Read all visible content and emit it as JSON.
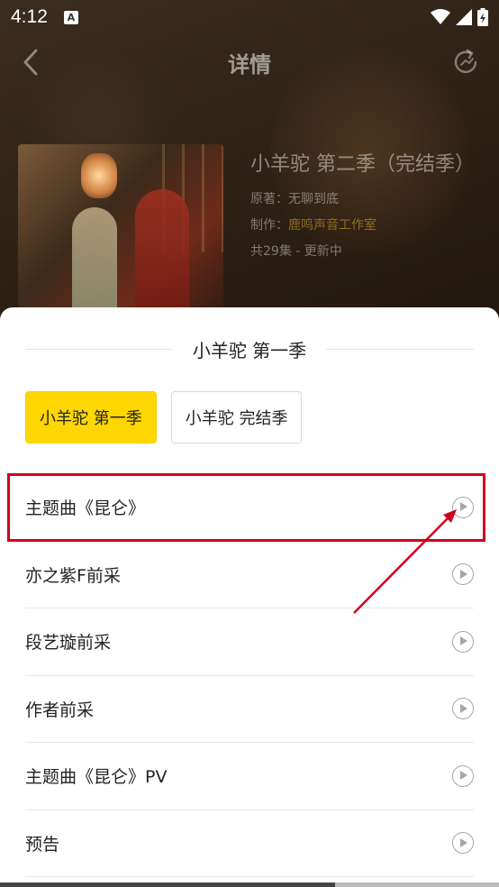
{
  "status_bar": {
    "time": "4:12",
    "notification_badge": "A"
  },
  "nav": {
    "title": "详情",
    "back_icon": "chevron-left-icon",
    "refresh_icon": "refresh-icon"
  },
  "album": {
    "title": "小羊驼 第二季（完结季）",
    "author": "原著：无聊到底",
    "producer_label": "制作：",
    "producer": "鹿鸣声音工作室",
    "episodes": "共29集 - 更新中"
  },
  "sheet": {
    "title": "小羊驼 第一季",
    "seasons": [
      {
        "label": "小羊驼  第一季",
        "active": true
      },
      {
        "label": "小羊驼  完结季",
        "active": false
      }
    ],
    "tracks": [
      {
        "name": "主题曲《昆仑》",
        "icon": "play-circle-icon"
      },
      {
        "name": "亦之紫F前采",
        "icon": "play-circle-icon"
      },
      {
        "name": "段艺璇前采",
        "icon": "play-circle-icon"
      },
      {
        "name": "作者前采",
        "icon": "play-circle-icon"
      },
      {
        "name": "主题曲《昆仑》PV",
        "icon": "play-circle-icon"
      },
      {
        "name": "预告",
        "icon": "play-circle-icon"
      }
    ]
  },
  "colors": {
    "accent": "#ffd700",
    "annotation": "#d0021b"
  }
}
